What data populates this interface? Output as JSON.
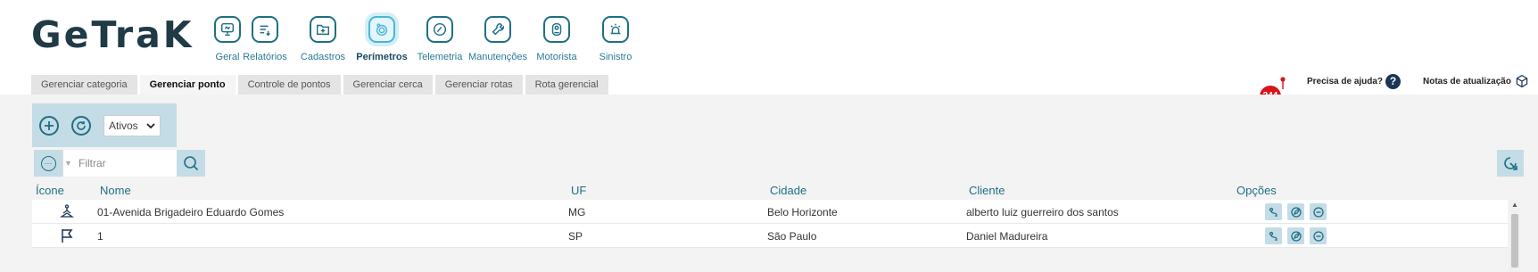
{
  "app": {
    "logo": "GeTraK"
  },
  "nav": [
    {
      "label": "Geral",
      "icon": "monitor-icon"
    },
    {
      "label": "Relatórios",
      "icon": "report-icon"
    },
    {
      "label": "Cadastros",
      "icon": "folder-plus-icon"
    },
    {
      "label": "Perímetros",
      "icon": "perimeter-icon",
      "active": true
    },
    {
      "label": "Telemetria",
      "icon": "telemetry-icon"
    },
    {
      "label": "Manutenções",
      "icon": "wrench-icon"
    },
    {
      "label": "Motorista",
      "icon": "driver-icon"
    },
    {
      "label": "Sinistro",
      "icon": "alarm-icon"
    }
  ],
  "tabs": [
    {
      "label": "Gerenciar categoria"
    },
    {
      "label": "Gerenciar ponto",
      "active": true
    },
    {
      "label": "Controle de pontos"
    },
    {
      "label": "Gerenciar cerca"
    },
    {
      "label": "Gerenciar rotas"
    },
    {
      "label": "Rota gerencial"
    }
  ],
  "header_right": {
    "notification_count": "244",
    "help_label": "Precisa de ajuda?",
    "help_icon_text": "?",
    "notes_label": "Notas de atualização"
  },
  "toolbar": {
    "status_select": {
      "value": "Ativos",
      "options": [
        "Ativos"
      ]
    }
  },
  "filter": {
    "placeholder": "Filtrar",
    "value": ""
  },
  "table": {
    "columns": [
      "Ícone",
      "Nome",
      "UF",
      "Cidade",
      "Cliente",
      "Opções"
    ],
    "rows": [
      {
        "icon": "map-pin-icon",
        "nome": "01-Avenida Brigadeiro Eduardo Gomes",
        "uf": "MG",
        "cidade": "Belo Horizonte",
        "cliente": "alberto luiz guerreiro dos santos"
      },
      {
        "icon": "flag-icon",
        "nome": "1",
        "uf": "SP",
        "cidade": "São Paulo",
        "cliente": "Daniel Madureira"
      }
    ]
  },
  "colors": {
    "brand": "#203a46",
    "accent": "#1e6f85",
    "accent_light": "#c4dce6",
    "badge": "#d8141b"
  }
}
